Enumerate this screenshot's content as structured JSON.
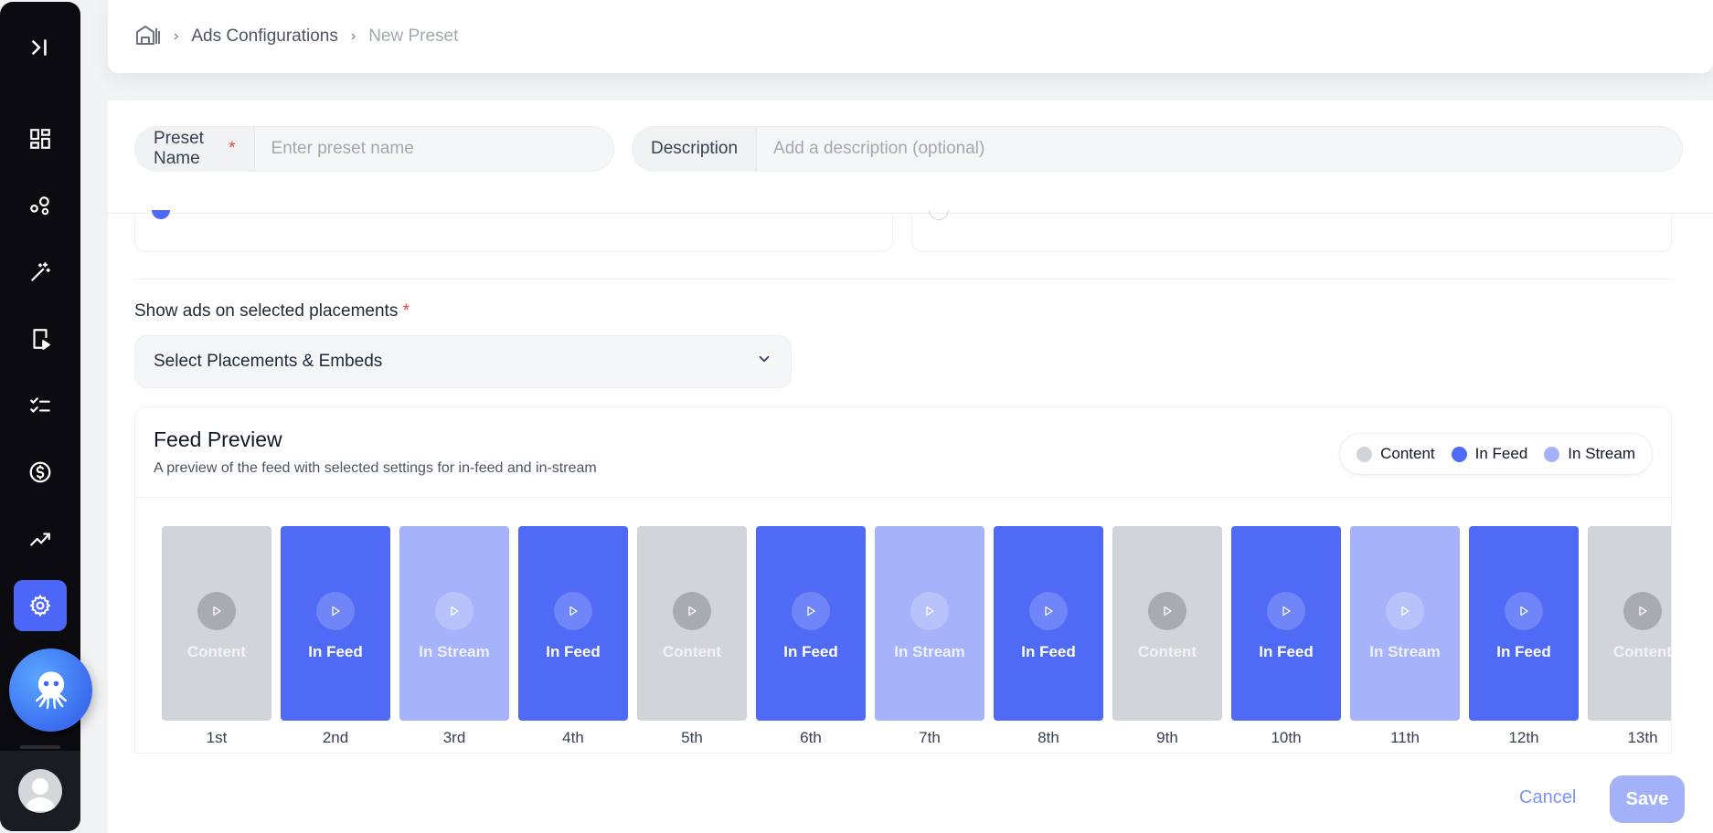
{
  "sidebar": {
    "icons": [
      "collapse-icon",
      "dashboard-icon",
      "network-icon",
      "magic-wand-icon",
      "video-device-icon",
      "checklist-icon",
      "dollar-icon",
      "analytics-icon",
      "settings-icon"
    ],
    "active": "settings-icon"
  },
  "breadcrumb": {
    "home_icon": "home-icon",
    "items": [
      "Ads Configurations",
      "New Preset"
    ]
  },
  "form": {
    "preset_name_label": "Preset Name",
    "preset_name_placeholder": "Enter preset name",
    "preset_name_value": "",
    "description_label": "Description",
    "description_placeholder": "Add a description (optional)",
    "description_value": "",
    "required_mark": "*",
    "placements_label": "Show ads on selected placements",
    "placements_select": "Select Placements & Embeds"
  },
  "preview": {
    "title": "Feed Preview",
    "subtitle": "A preview of the feed with selected settings for in-feed and in-stream",
    "legend": [
      {
        "label": "Content",
        "color": "#d1d5db"
      },
      {
        "label": "In Feed",
        "color": "#4f6af5"
      },
      {
        "label": "In Stream",
        "color": "#a6b3fa"
      }
    ],
    "tiles": [
      {
        "type": "content",
        "label": "Content",
        "index": "1st"
      },
      {
        "type": "feed",
        "label": "In Feed",
        "index": "2nd"
      },
      {
        "type": "stream",
        "label": "In Stream",
        "index": "3rd"
      },
      {
        "type": "feed",
        "label": "In Feed",
        "index": "4th"
      },
      {
        "type": "content",
        "label": "Content",
        "index": "5th"
      },
      {
        "type": "feed",
        "label": "In Feed",
        "index": "6th"
      },
      {
        "type": "stream",
        "label": "In Stream",
        "index": "7th"
      },
      {
        "type": "feed",
        "label": "In Feed",
        "index": "8th"
      },
      {
        "type": "content",
        "label": "Content",
        "index": "9th"
      },
      {
        "type": "feed",
        "label": "In Feed",
        "index": "10th"
      },
      {
        "type": "stream",
        "label": "In Stream",
        "index": "11th"
      },
      {
        "type": "feed",
        "label": "In Feed",
        "index": "12th"
      },
      {
        "type": "content",
        "label": "Content",
        "index": "13th"
      }
    ]
  },
  "actions": {
    "cancel": "Cancel",
    "save": "Save"
  }
}
